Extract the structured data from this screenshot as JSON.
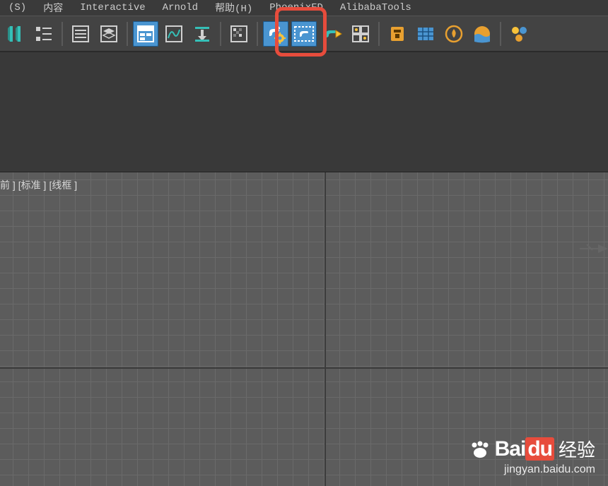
{
  "menu": {
    "scripts": "(S)",
    "content": "内容",
    "interactive": "Interactive",
    "arnold": "Arnold",
    "help": "帮助(H)",
    "phoenix": "PhoenixFD",
    "alibaba": "AlibabaTools"
  },
  "viewport": {
    "label_front": "前 ]",
    "label_standard": "[标准 ]",
    "label_wireframe": "[线框 ]"
  },
  "watermark": {
    "brand_bai": "Bai",
    "brand_du": "du",
    "brand_cn": "经验",
    "url": "jingyan.baidu.com"
  },
  "colors": {
    "accent": "#4a95d1",
    "orange": "#e8a030",
    "teal": "#35c0b8",
    "yellow": "#f8c23a",
    "red_highlight": "#e74c3c"
  }
}
